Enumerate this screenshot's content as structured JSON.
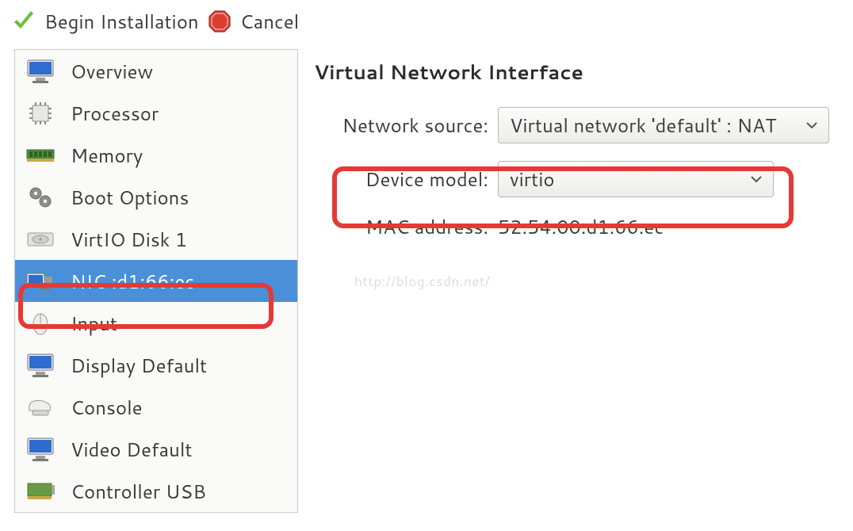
{
  "toolbar": {
    "begin_label": "Begin Installation",
    "cancel_label": "Cancel"
  },
  "sidebar": {
    "items": [
      {
        "label": "Overview",
        "icon": "monitor"
      },
      {
        "label": "Processor",
        "icon": "cpu"
      },
      {
        "label": "Memory",
        "icon": "ram"
      },
      {
        "label": "Boot Options",
        "icon": "gears"
      },
      {
        "label": "VirtIO Disk 1",
        "icon": "disk"
      },
      {
        "label": "NIC :d1:66:ec",
        "icon": "nic",
        "selected": true
      },
      {
        "label": "Input",
        "icon": "mouse"
      },
      {
        "label": "Display Default",
        "icon": "monitor"
      },
      {
        "label": "Console",
        "icon": "serial"
      },
      {
        "label": "Video Default",
        "icon": "monitor"
      },
      {
        "label": "Controller USB",
        "icon": "pci"
      }
    ]
  },
  "main": {
    "title": "Virtual Network Interface",
    "network_source_label": "Network source:",
    "network_source_value": "Virtual network 'default' : NAT",
    "device_model_label": "Device model:",
    "device_model_value": "virtio",
    "mac_label": "MAC address:",
    "mac_value": "52:54:00:d1:66:ec"
  },
  "watermark": "http://blog.csdn.net/"
}
